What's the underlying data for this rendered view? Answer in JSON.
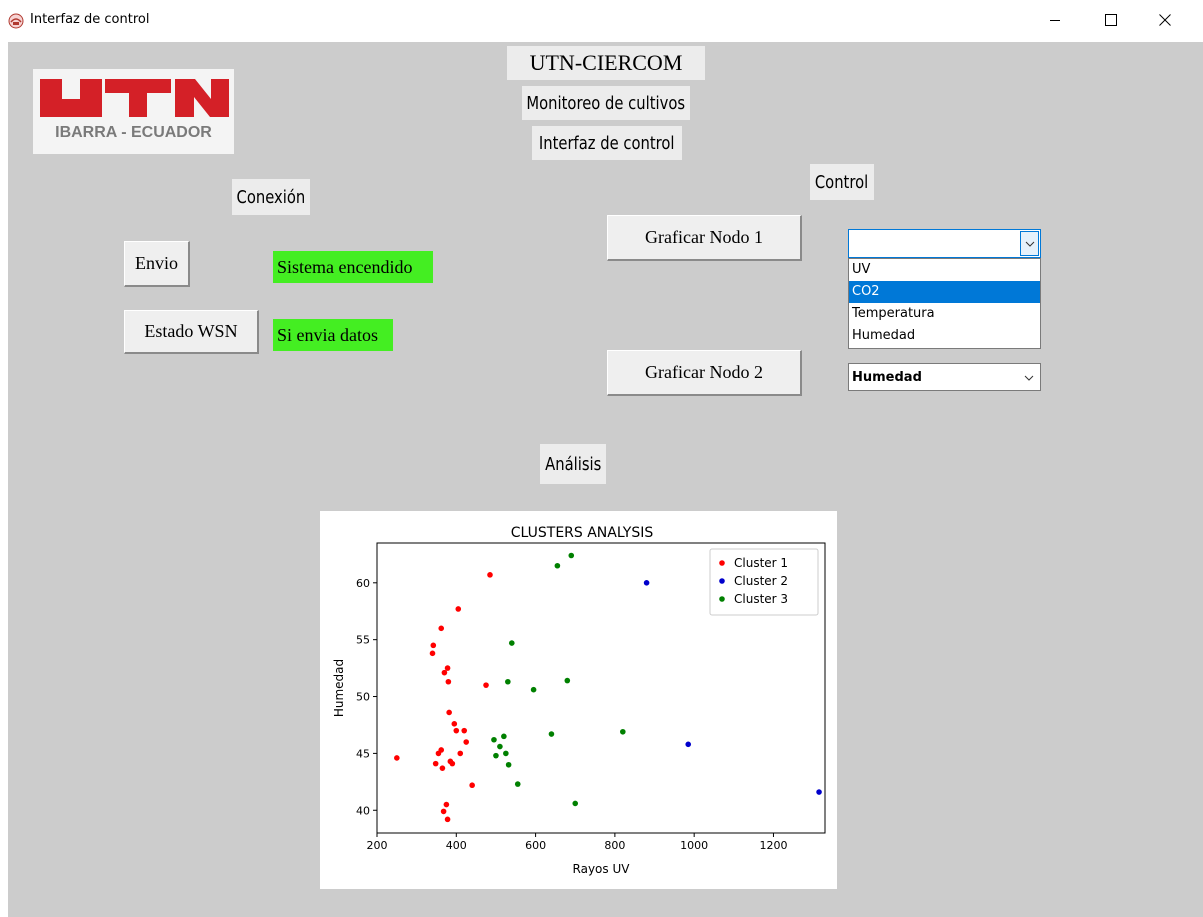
{
  "window": {
    "title": "Interfaz de control",
    "app_icon": "app-emblem-icon",
    "controls": {
      "minimize": "minimize-icon",
      "maximize": "maximize-icon",
      "close": "close-icon"
    }
  },
  "header": {
    "org": "UTN-CIERCOM",
    "subtitle": "Monitoreo de cultivos",
    "title": "Interfaz de control"
  },
  "logo": {
    "caption": "IBARRA - ECUADOR",
    "brand_color": "#d42027"
  },
  "connection": {
    "section_label": "Conexión",
    "send_button": "Envio",
    "status_button": "Estado WSN",
    "system_status": "Sistema encendido",
    "data_status": "Si envia datos",
    "status_color": "#44ee22"
  },
  "control": {
    "section_label": "Control",
    "graph_node1_button": "Graficar Nodo 1",
    "graph_node2_button": "Graficar Nodo 2",
    "node1_select": {
      "value": "",
      "options": [
        "UV",
        "CO2",
        "Temperatura",
        "Humedad"
      ],
      "highlighted": "CO2"
    },
    "node2_select": {
      "value": "Humedad"
    }
  },
  "analysis": {
    "section_label": "Análisis"
  },
  "chart_data": {
    "type": "scatter",
    "title": "CLUSTERS ANALYSIS",
    "xlabel": "Rayos UV",
    "ylabel": "Humedad",
    "xlim": [
      200,
      1330
    ],
    "ylim": [
      38,
      63.5
    ],
    "xticks": [
      200,
      400,
      600,
      800,
      1000,
      1200
    ],
    "yticks": [
      40,
      45,
      50,
      55,
      60
    ],
    "legend_position": "top-right",
    "series": [
      {
        "name": "Cluster 1",
        "color": "#ff0000",
        "points": [
          [
            250,
            44.6
          ],
          [
            340,
            53.8
          ],
          [
            342,
            54.5
          ],
          [
            348,
            44.1
          ],
          [
            355,
            45.0
          ],
          [
            362,
            56.0
          ],
          [
            362,
            45.3
          ],
          [
            365,
            43.7
          ],
          [
            370,
            52.1
          ],
          [
            368,
            39.9
          ],
          [
            375,
            40.5
          ],
          [
            378,
            39.2
          ],
          [
            378,
            52.5
          ],
          [
            380,
            51.3
          ],
          [
            382,
            48.6
          ],
          [
            385,
            44.3
          ],
          [
            390,
            44.1
          ],
          [
            395,
            47.6
          ],
          [
            400,
            47.0
          ],
          [
            405,
            57.7
          ],
          [
            410,
            45.0
          ],
          [
            420,
            47.0
          ],
          [
            425,
            46.0
          ],
          [
            440,
            42.2
          ],
          [
            475,
            51.0
          ],
          [
            485,
            60.7
          ]
        ]
      },
      {
        "name": "Cluster 2",
        "color": "#0000cc",
        "points": [
          [
            880,
            60.0
          ],
          [
            985,
            45.8
          ],
          [
            1315,
            41.6
          ]
        ]
      },
      {
        "name": "Cluster 3",
        "color": "#008000",
        "points": [
          [
            495,
            46.2
          ],
          [
            500,
            44.8
          ],
          [
            510,
            45.6
          ],
          [
            520,
            46.5
          ],
          [
            525,
            45.0
          ],
          [
            530,
            51.3
          ],
          [
            532,
            44.0
          ],
          [
            540,
            54.7
          ],
          [
            555,
            42.3
          ],
          [
            595,
            50.6
          ],
          [
            640,
            46.7
          ],
          [
            655,
            61.5
          ],
          [
            680,
            51.4
          ],
          [
            690,
            62.4
          ],
          [
            700,
            40.6
          ],
          [
            820,
            46.9
          ]
        ]
      }
    ]
  }
}
